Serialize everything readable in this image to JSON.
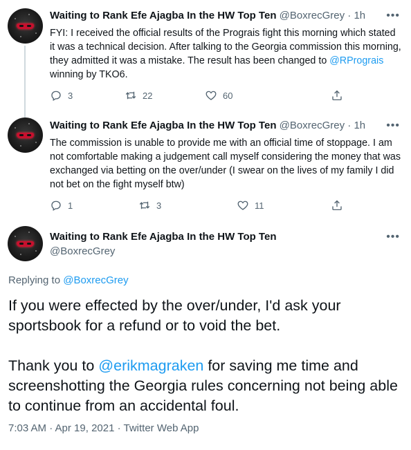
{
  "tweets": [
    {
      "name": "Waiting to Rank Efe Ajagba In the HW Top Ten",
      "handle": "@BoxrecGrey",
      "dot": "·",
      "time": "1h",
      "text_before": "FYI: I received the official results of the Prograis fight this morning which stated it was a technical decision. After talking to the Georgia commission this morning, they admitted it was a mistake. The result has been changed to ",
      "mention": "@RPrograis",
      "text_after": " winning by TKO6.",
      "replies": "3",
      "retweets": "22",
      "likes": "60"
    },
    {
      "name": "Waiting to Rank Efe Ajagba In the HW Top Ten",
      "handle": "@BoxrecGrey",
      "dot": "·",
      "time": "1h",
      "text": "The commission is unable to provide me with an official time of stoppage. I am not comfortable making a judgement call myself considering the money that was exchanged via betting on the over/under (I swear on the lives of my family I did not bet on the fight myself btw)",
      "replies": "1",
      "retweets": "3",
      "likes": "11"
    }
  ],
  "main_tweet": {
    "name": "Waiting to Rank Efe Ajagba In the HW Top Ten",
    "handle": "@BoxrecGrey",
    "replying_label": "Replying to ",
    "replying_to": "@BoxrecGrey",
    "paragraph1": "If you were effected by the over/under, I'd ask your sportsbook for a refund or to void the bet.",
    "p2_before": "Thank you to ",
    "p2_mention": "@erikmagraken",
    "p2_after": " for saving me time and screenshotting the Georgia rules concerning not being able to continue from an accidental foul.",
    "timestamp": "7:03 AM · Apr 19, 2021 · Twitter Web App"
  },
  "icons": {
    "reply": "reply-icon",
    "retweet": "retweet-icon",
    "like": "heart-icon",
    "share": "share-icon",
    "more": "more-icon"
  },
  "colors": {
    "link": "#1d9bf0",
    "secondary_text": "#536471",
    "thread_line": "#cfd9de"
  }
}
